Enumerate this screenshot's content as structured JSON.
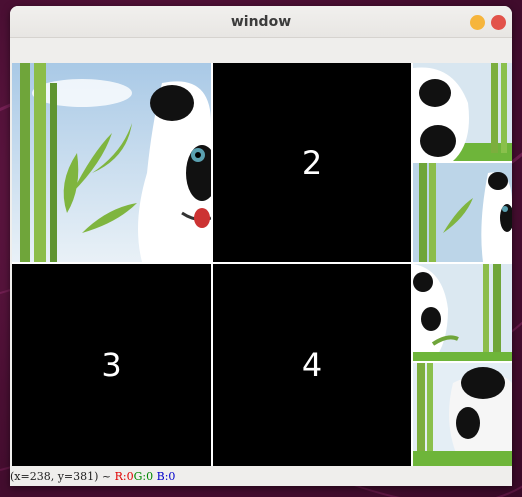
{
  "window": {
    "title": "window"
  },
  "tiles": {
    "two": "2",
    "three": "3",
    "four": "4"
  },
  "status": {
    "coords": "(x=238, y=381) ~",
    "r": "R:0",
    "g": "G:0",
    "b": "B:0"
  },
  "colors": {
    "minimize": "#f6b53c",
    "close": "#e2524a",
    "r_text": "#e00000",
    "g_text": "#008800",
    "b_text": "#0000cc"
  }
}
